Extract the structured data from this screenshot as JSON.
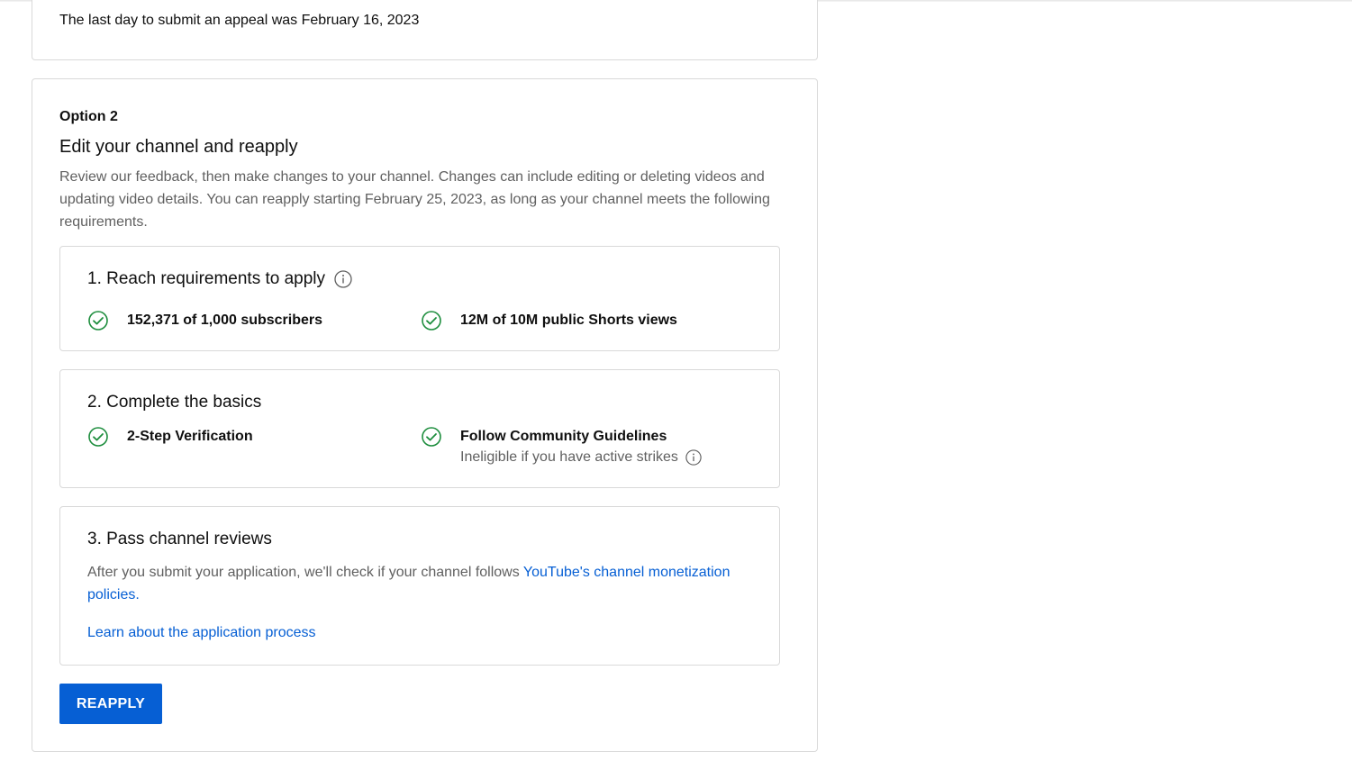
{
  "appeal": {
    "deadline_text": "The last day to submit an appeal was February 16, 2023"
  },
  "option2": {
    "label": "Option 2",
    "title": "Edit your channel and reapply",
    "description": "Review our feedback, then make changes to your channel. Changes can include editing or deleting videos and updating video details. You can reapply starting February 25, 2023, as long as your channel meets the following requirements."
  },
  "step1": {
    "title": "1. Reach requirements to apply",
    "items": [
      {
        "label": "152,371 of 1,000 subscribers",
        "icon": "check-circle-icon"
      },
      {
        "label": "12M of 10M public Shorts views",
        "icon": "check-circle-icon"
      }
    ]
  },
  "step2": {
    "title": "2. Complete the basics",
    "items": [
      {
        "label": "2-Step Verification",
        "icon": "check-circle-icon"
      },
      {
        "label": "Follow Community Guidelines",
        "sub": "Ineligible if you have active strikes",
        "icon": "check-circle-icon"
      }
    ]
  },
  "step3": {
    "title": "3. Pass channel reviews",
    "desc_prefix": "After you submit your application, we'll check if your channel follows ",
    "policy_link": "YouTube's channel monetization policies",
    "desc_suffix": ".",
    "learn_link": "Learn about the application process"
  },
  "actions": {
    "reapply_label": "REAPPLY"
  },
  "colors": {
    "accent": "#065fd4",
    "check_green": "#1e8e3e",
    "secondary_text": "#606060"
  }
}
